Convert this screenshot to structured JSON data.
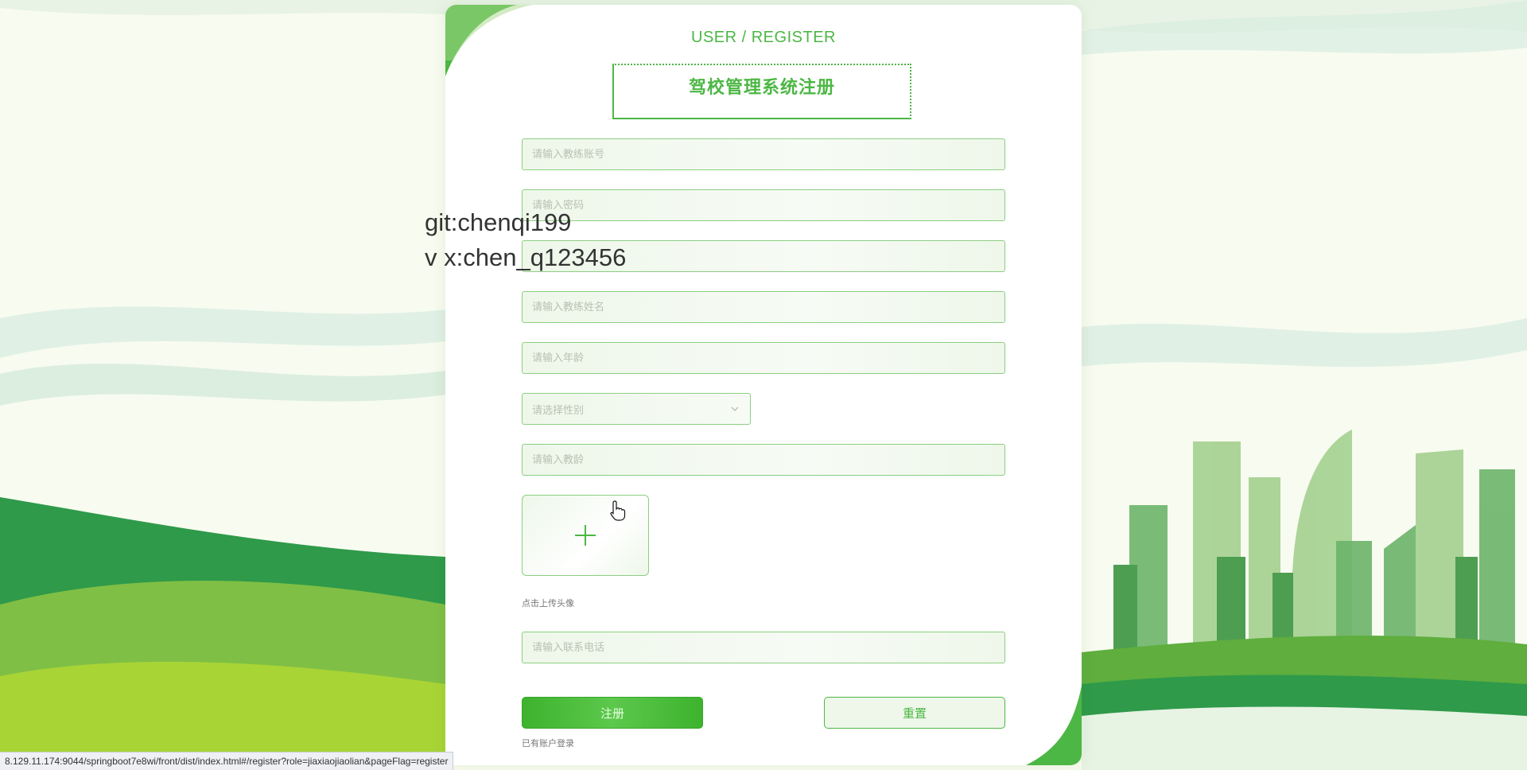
{
  "header": {
    "subtitle": "USER / REGISTER",
    "title": "驾校管理系统注册"
  },
  "form": {
    "account_placeholder": "请输入教练账号",
    "password_placeholder": "请输入密码",
    "confirm_password_placeholder": "",
    "name_placeholder": "请输入教练姓名",
    "age_placeholder": "请输入年龄",
    "gender_placeholder": "请选择性别",
    "teaching_years_placeholder": "请输入教龄",
    "avatar_hint": "点击上传头像",
    "phone_placeholder": "请输入联系电话"
  },
  "actions": {
    "register_label": "注册",
    "reset_label": "重置",
    "login_link": "已有账户登录"
  },
  "watermark": {
    "line1": "git:chenqi199",
    "line2": "v x:chen_q123456"
  },
  "statusbar": {
    "url": "8.129.11.174:9044/springboot7e8wi/front/dist/index.html#/register?role=jiaxiaojiaolian&pageFlag=register"
  },
  "icons": {
    "upload": "plus-icon",
    "select": "chevron-down-icon",
    "cursor": "hand-pointer-icon"
  },
  "colors": {
    "accent": "#4cb744",
    "field_border": "#8ccf82",
    "field_bg": "#eef7ea"
  }
}
